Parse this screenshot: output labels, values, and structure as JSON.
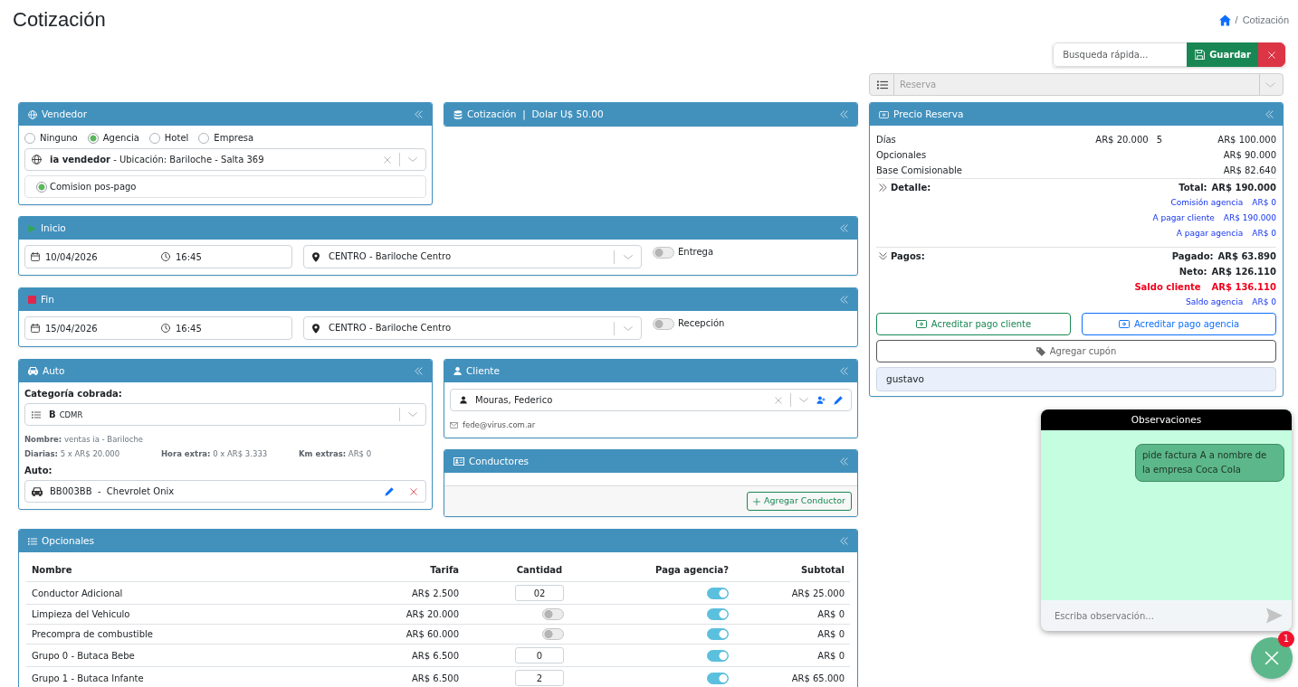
{
  "page": {
    "title": "Cotización",
    "breadcrumb": {
      "separator": "/",
      "current": "Cotización"
    }
  },
  "toolbar": {
    "search": {
      "placeholder": "Busqueda rápida..."
    },
    "save_button": "Guardar"
  },
  "reserva_select": {
    "placeholder": "Reserva",
    "disabled": true
  },
  "vendedor": {
    "title": "Vendedor",
    "types": [
      {
        "label": "Ninguno",
        "selected": false
      },
      {
        "label": "Agencia",
        "selected": true
      },
      {
        "label": "Hotel",
        "selected": false
      },
      {
        "label": "Empresa",
        "selected": false
      }
    ],
    "seller": "**ia vendedor** - Ubicación: Bariloche - Salta 369",
    "commission": {
      "label": "Comision pos-pago",
      "selected": true
    }
  },
  "cotizacion": {
    "title": "Cotización  |  Dolar U$ 50.00"
  },
  "inicio": {
    "title": "Inicio",
    "date": "10/04/2026",
    "time": "16:45",
    "location": "CENTRO - Bariloche Centro",
    "switch": {
      "label": "Entrega",
      "on": false
    }
  },
  "fin": {
    "title": "Fin",
    "date": "15/04/2026",
    "time": "16:45",
    "location": "CENTRO - Bariloche Centro",
    "switch": {
      "label": "Recepción",
      "on": false
    }
  },
  "auto": {
    "title": "Auto",
    "category_label": "Categoría cobrada:",
    "category": {
      "code": "B",
      "name": "CDMR"
    },
    "nombre": "**Nombre:** ventas ia - Bariloche",
    "rates": [
      "**Diarias:** 5 x AR$ 20.000",
      "**Hora extra:** 0 x AR$ 3.333",
      "**Km extras:** AR$ 0"
    ],
    "car_label": "Auto:",
    "car": "BB003BB  -  Chevrolet Onix"
  },
  "cliente": {
    "title": "Cliente",
    "name": "Mouras, Federico",
    "email": "fede@virus.com.ar"
  },
  "conductores": {
    "title": "Conductores",
    "add_button": "Agregar Conductor"
  },
  "opcionales": {
    "title": "Opcionales",
    "columns": [
      "Nombre",
      "Tarifa",
      "Cantidad",
      "Paga agencia?",
      "Subtotal"
    ],
    "rows": [
      {
        "name": "Conductor Adicional",
        "tarifa": "AR$ 2.500",
        "cantidad": {
          "kind": "input",
          "value": "02"
        },
        "paga_agencia": true,
        "subtotal": "AR$ 25.000"
      },
      {
        "name": "Limpieza del Vehiculo",
        "tarifa": "AR$ 20.000",
        "cantidad": {
          "kind": "switch",
          "on": false
        },
        "paga_agencia": true,
        "subtotal": "AR$ 0"
      },
      {
        "name": "Precompra de combustible",
        "tarifa": "AR$ 60.000",
        "cantidad": {
          "kind": "switch",
          "on": false
        },
        "paga_agencia": true,
        "subtotal": "AR$ 0"
      },
      {
        "name": "Grupo 0 - Butaca Bebe",
        "tarifa": "AR$ 6.500",
        "cantidad": {
          "kind": "input",
          "value": "0"
        },
        "paga_agencia": true,
        "subtotal": "AR$ 0"
      },
      {
        "name": "Grupo 1 - Butaca Infante",
        "tarifa": "AR$ 6.500",
        "cantidad": {
          "kind": "input",
          "value": "2"
        },
        "paga_agencia": true,
        "subtotal": "AR$ 65.000"
      }
    ]
  },
  "precio": {
    "title": "Precio Reserva",
    "lines": [
      {
        "label": "Días",
        "rate": "AR$ 20.000",
        "quantity": "5",
        "amount": "AR$ 100.000"
      },
      {
        "label": "Opcionales",
        "amount": "AR$ 90.000"
      },
      {
        "label": "Base Comisionable",
        "amount": "AR$ 82.640"
      }
    ],
    "sections": [
      {
        "label": "Detalle:",
        "expanded": false,
        "lines": [
          {
            "label": "Total:",
            "value": "AR$ 190.000",
            "kind": "total"
          },
          {
            "label": "Comisión agencia",
            "value": "AR$ 0",
            "kind": "link"
          },
          {
            "label": "A pagar cliente",
            "value": "AR$ 190.000",
            "kind": "link"
          },
          {
            "label": "A pagar agencia",
            "value": "AR$ 0",
            "kind": "link"
          }
        ]
      },
      {
        "label": "Pagos:",
        "expanded": true,
        "lines": [
          {
            "label": "Pagado:",
            "value": "AR$ 63.890",
            "kind": "total"
          },
          {
            "label": "Neto:",
            "value": "AR$ 126.110",
            "kind": "total"
          },
          {
            "label": "Saldo cliente",
            "value": "AR$ 136.110",
            "kind": "alert"
          },
          {
            "label": "Saldo agencia",
            "value": "AR$ 0",
            "kind": "link"
          }
        ]
      }
    ],
    "payment_buttons": [
      {
        "label": "Acreditar pago cliente",
        "kind": "success"
      },
      {
        "label": "Acreditar pago agencia",
        "kind": "primary"
      }
    ],
    "coupon_button": "Agregar cupón",
    "user": "gustavo"
  },
  "observaciones": {
    "title": "Observaciones",
    "messages": [
      {
        "text": "pide factura A a nombre de la empresa Coca Cola"
      }
    ],
    "input": {
      "placeholder": "Escriba observación..."
    }
  },
  "chat_button": {
    "badge": "1"
  }
}
